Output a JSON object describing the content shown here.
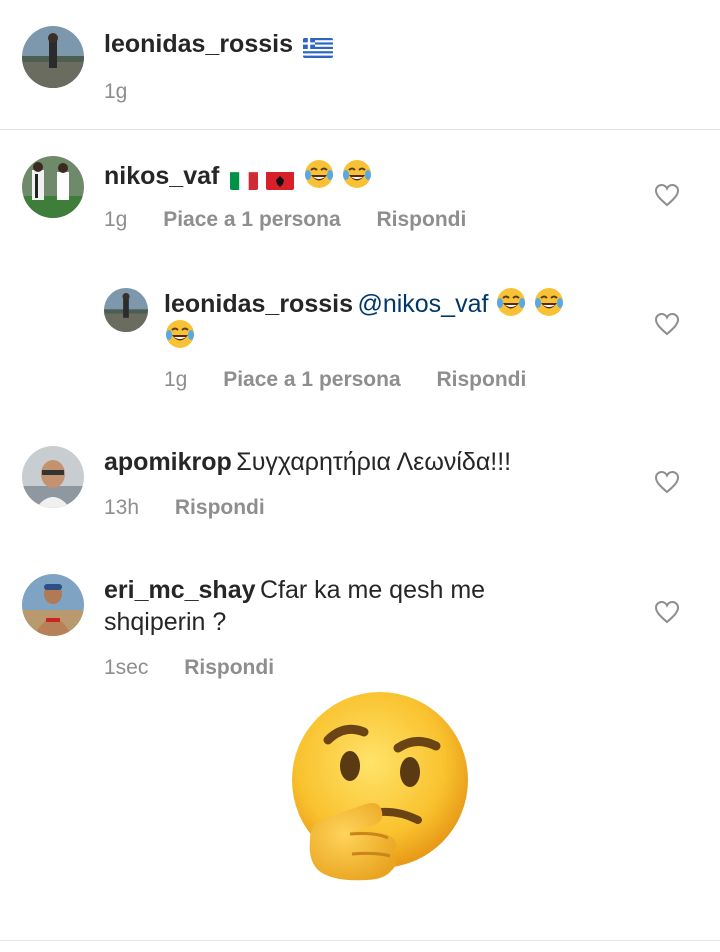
{
  "caption": {
    "username": "leonidas_rossis",
    "time": "1g"
  },
  "comments": [
    {
      "username": "nikos_vaf",
      "time": "1g",
      "likes": "Piace a 1 persona",
      "reply": "Rispondi"
    },
    {
      "username": "leonidas_rossis",
      "mention": "@nikos_vaf",
      "time": "1g",
      "likes": "Piace a 1 persona",
      "reply": "Rispondi"
    },
    {
      "username": "apomikrop",
      "text": "Συγχαρητήρια Λεωνίδα!!!",
      "time": "13h",
      "reply": "Rispondi"
    },
    {
      "username": "eri_mc_shay",
      "text_line1": "Cfar ka me qesh me",
      "text_line2": "shqiperin ?",
      "time": "1sec",
      "reply": "Rispondi"
    }
  ],
  "icons": {
    "heart": "heart-outline-icon",
    "laugh": "tears-of-joy-emoji",
    "thinking": "thinking-face-emoji"
  },
  "colors": {
    "text": "#262626",
    "meta": "#8e8e8e",
    "link": "#00376b",
    "divider": "#e3e3e3"
  }
}
